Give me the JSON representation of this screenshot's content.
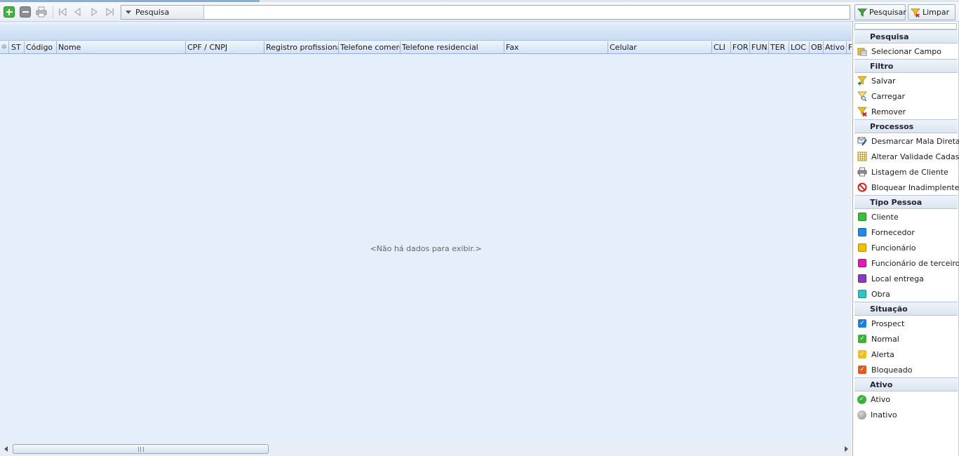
{
  "toolbar": {
    "search_mode": "Pesquisa",
    "search_placeholder": "",
    "btn_search": "Pesquisar",
    "btn_clear": "Limpar"
  },
  "grid": {
    "indicator": "✲",
    "columns": [
      {
        "label": "ST"
      },
      {
        "label": "Código"
      },
      {
        "label": "Nome"
      },
      {
        "label": "CPF / CNPJ"
      },
      {
        "label": "Registro profissional"
      },
      {
        "label": "Telefone comercial"
      },
      {
        "label": "Telefone residencial"
      },
      {
        "label": "Fax"
      },
      {
        "label": "Celular"
      },
      {
        "label": "CLI"
      },
      {
        "label": "FOR"
      },
      {
        "label": "FUN"
      },
      {
        "label": "TER"
      },
      {
        "label": "LOC"
      },
      {
        "label": "OBI"
      },
      {
        "label": "Ativo"
      },
      {
        "label": "F"
      }
    ],
    "empty_message": "<Não há dados para exibir.>"
  },
  "side": {
    "sections": [
      {
        "title": "Pesquisa",
        "items": [
          {
            "label": "Selecionar Campo",
            "icon": "select-field-icon"
          }
        ]
      },
      {
        "title": "Filtro",
        "items": [
          {
            "label": "Salvar",
            "icon": "filter-save-icon"
          },
          {
            "label": "Carregar",
            "icon": "filter-load-icon"
          },
          {
            "label": "Remover",
            "icon": "filter-remove-icon"
          }
        ]
      },
      {
        "title": "Processos",
        "items": [
          {
            "label": "Desmarcar Mala Direta",
            "icon": "mail-unmark-icon"
          },
          {
            "label": "Alterar Validade Cadas",
            "icon": "calendar-grid-icon"
          },
          {
            "label": "Listagem de Cliente",
            "icon": "printer-icon"
          },
          {
            "label": "Bloquear Inadimplentes",
            "icon": "block-icon"
          }
        ]
      },
      {
        "title": "Tipo Pessoa",
        "items": [
          {
            "label": "Cliente",
            "color": "#3cbf3a"
          },
          {
            "label": "Fornecedor",
            "color": "#1e8be8"
          },
          {
            "label": "Funcionário",
            "color": "#f2c200"
          },
          {
            "label": "Funcionário de terceiros",
            "color": "#e21bb8"
          },
          {
            "label": "Local entrega",
            "color": "#8a3bbf"
          },
          {
            "label": "Obra",
            "color": "#2cc6c9"
          }
        ]
      },
      {
        "title": "Situação",
        "items": [
          {
            "label": "Prospect",
            "color": "#1e7fd8"
          },
          {
            "label": "Normal",
            "color": "#3bb33a"
          },
          {
            "label": "Alerta",
            "color": "#f0c020"
          },
          {
            "label": "Bloqueado",
            "color": "#e25a1c"
          }
        ]
      },
      {
        "title": "Ativo",
        "items": [
          {
            "label": "Ativo",
            "color": "#3bb33a"
          },
          {
            "label": "Inativo",
            "color": "#9a9a9a"
          }
        ]
      }
    ]
  }
}
